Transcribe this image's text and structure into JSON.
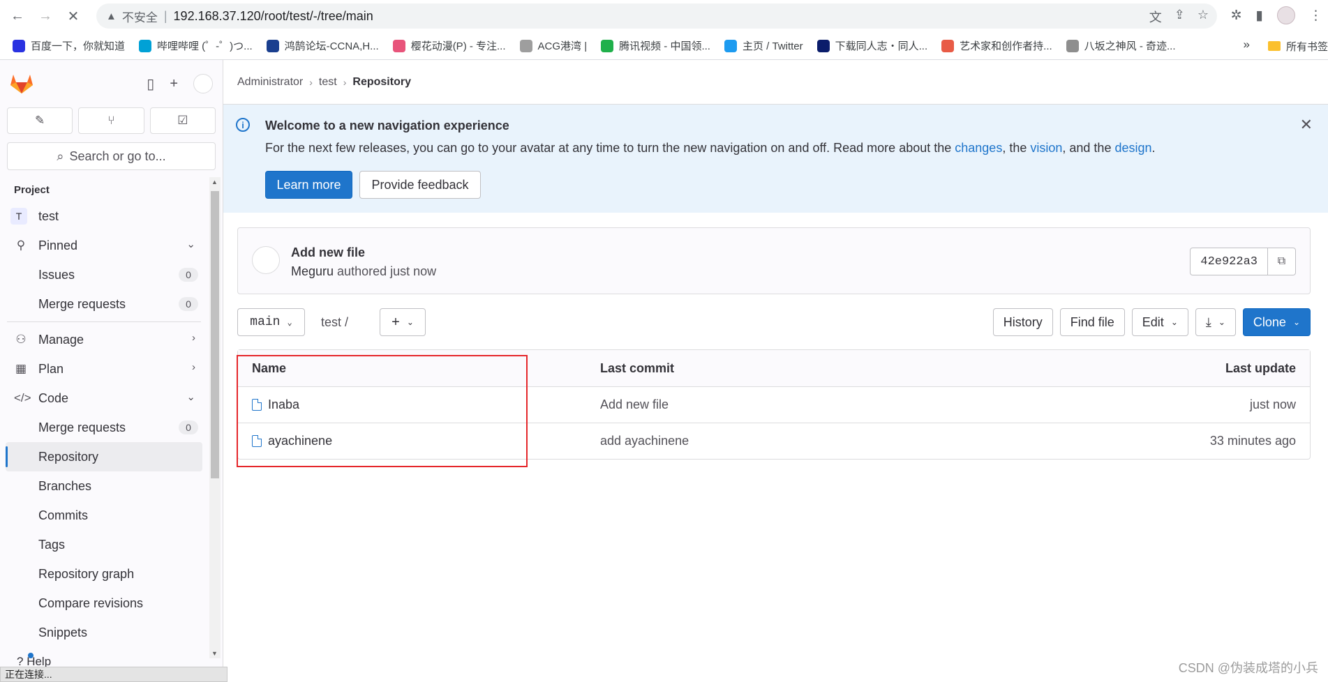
{
  "browser": {
    "back_icon": "arrow-left-icon",
    "forward_icon": "arrow-right-icon",
    "stop_icon": "close-icon",
    "insecure_label": "不安全",
    "url": "192.168.37.120/root/test/-/tree/main",
    "bookmarks": [
      {
        "label": "百度一下，你就知道",
        "color": "#2932e1"
      },
      {
        "label": "哔哩哔哩 (゜-゜)つ...",
        "color": "#00a1d6"
      },
      {
        "label": "鸿鹄论坛-CCNA,H...",
        "color": "#1a3f8f"
      },
      {
        "label": "樱花动漫(P) - 专注...",
        "color": "#e8547b"
      },
      {
        "label": "ACG港湾 |",
        "color": "#9e9e9e"
      },
      {
        "label": "腾讯视频 - 中国领...",
        "color": "#20b04b"
      },
      {
        "label": "主页 / Twitter",
        "color": "#1d9bf0"
      },
      {
        "label": "下载同人志・同人...",
        "color": "#0b1d6b"
      },
      {
        "label": "艺术家和创作者持...",
        "color": "#e85b46"
      },
      {
        "label": "八坂之神风 - 奇迹...",
        "color": "#8e8e8e"
      }
    ],
    "bookmarks_more": "»",
    "bookmarks_folder": "所有书签",
    "status_text": "正在连接..."
  },
  "sidebar": {
    "search_label": "Search or go to...",
    "section_heading": "Project",
    "project_initial": "T",
    "project_name": "test",
    "pinned_label": "Pinned",
    "pinned_items": [
      {
        "label": "Issues",
        "count": "0"
      },
      {
        "label": "Merge requests",
        "count": "0"
      }
    ],
    "manage_label": "Manage",
    "plan_label": "Plan",
    "code_label": "Code",
    "code_items": [
      {
        "label": "Merge requests",
        "count": "0"
      },
      {
        "label": "Repository"
      },
      {
        "label": "Branches"
      },
      {
        "label": "Commits"
      },
      {
        "label": "Tags"
      },
      {
        "label": "Repository graph"
      },
      {
        "label": "Compare revisions"
      },
      {
        "label": "Snippets"
      }
    ],
    "help_label": "Help"
  },
  "breadcrumb": [
    "Administrator",
    "test",
    "Repository"
  ],
  "banner": {
    "title": "Welcome to a new navigation experience",
    "text_before": "For the next few releases, you can go to your avatar at any time to turn the new navigation on and off. Read more about the ",
    "link_changes": "changes",
    "text_mid1": ", the ",
    "link_vision": "vision",
    "text_mid2": ", and the ",
    "link_design": "design",
    "text_end": ".",
    "learn_more": "Learn more",
    "feedback": "Provide feedback"
  },
  "last_commit": {
    "title": "Add new file",
    "author": "Meguru",
    "meta": "authored just now",
    "sha": "42e922a3"
  },
  "toolbar": {
    "branch": "main",
    "path": "test",
    "path_sep": "/",
    "history": "History",
    "find_file": "Find file",
    "edit": "Edit",
    "clone": "Clone"
  },
  "file_tree": {
    "headers": {
      "name": "Name",
      "last_commit": "Last commit",
      "last_update": "Last update"
    },
    "rows": [
      {
        "name": "Inaba",
        "commit": "Add new file",
        "updated": "just now"
      },
      {
        "name": "ayachinene",
        "commit": "add ayachinene",
        "updated": "33 minutes ago"
      }
    ]
  },
  "watermark": "CSDN @伪装成塔的小兵",
  "colors": {
    "accent": "#1f75cb",
    "highlight_box": "#e5262a",
    "banner_bg": "#e9f3fc"
  }
}
